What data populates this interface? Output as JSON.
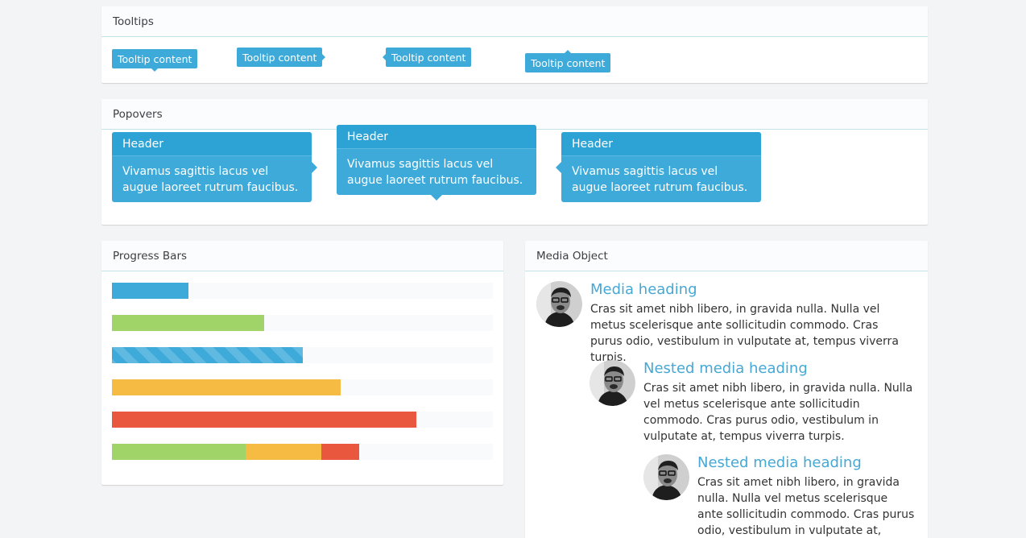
{
  "tooltips": {
    "title": "Tooltips",
    "items": [
      {
        "label": "Tooltip content",
        "placement": "bottom"
      },
      {
        "label": "Tooltip content",
        "placement": "right"
      },
      {
        "label": "Tooltip content",
        "placement": "left"
      },
      {
        "label": "Tooltip content",
        "placement": "top"
      }
    ]
  },
  "popovers": {
    "title": "Popovers",
    "items": [
      {
        "header": "Header",
        "body": "Vivamus sagittis lacus vel augue laoreet rutrum faucibus.",
        "placement": "right"
      },
      {
        "header": "Header",
        "body": "Vivamus sagittis lacus vel augue laoreet rutrum faucibus.",
        "placement": "bottom"
      },
      {
        "header": "Header",
        "body": "Vivamus sagittis lacus vel augue laoreet rutrum faucibus.",
        "placement": "left"
      }
    ]
  },
  "progress": {
    "title": "Progress Bars",
    "bars": [
      {
        "segments": [
          {
            "percent": 20,
            "color": "#3daad9"
          }
        ]
      },
      {
        "segments": [
          {
            "percent": 40,
            "color": "#a0d468"
          }
        ]
      },
      {
        "segments": [
          {
            "percent": 50,
            "color": "#3daad9",
            "striped": true
          }
        ]
      },
      {
        "segments": [
          {
            "percent": 60,
            "color": "#f6bb42"
          }
        ]
      },
      {
        "segments": [
          {
            "percent": 80,
            "color": "#e9573f"
          }
        ]
      },
      {
        "segments": [
          {
            "percent": 35,
            "color": "#a0d468"
          },
          {
            "percent": 20,
            "color": "#f6bb42"
          },
          {
            "percent": 10,
            "color": "#e9573f"
          }
        ]
      }
    ]
  },
  "media": {
    "title": "Media Object",
    "items": [
      {
        "heading": "Media heading",
        "text": "Cras sit amet nibh libero, in gravida nulla. Nulla vel metus scelerisque ante sollicitudin commodo. Cras purus odio, vestibulum in vulputate at, tempus viverra turpis.",
        "avatar_icon": "user-avatar-icon"
      },
      {
        "heading": "Nested media heading",
        "text": "Cras sit amet nibh libero, in gravida nulla. Nulla vel metus scelerisque ante sollicitudin commodo. Cras purus odio, vestibulum in vulputate at, tempus viverra turpis.",
        "avatar_icon": "user-avatar-icon"
      },
      {
        "heading": "Nested media heading",
        "text": "Cras sit amet nibh libero, in gravida nulla. Nulla vel metus scelerisque ante sollicitudin commodo. Cras purus odio, vestibulum in vulputate at, tempus",
        "avatar_icon": "user-avatar-icon"
      }
    ]
  }
}
